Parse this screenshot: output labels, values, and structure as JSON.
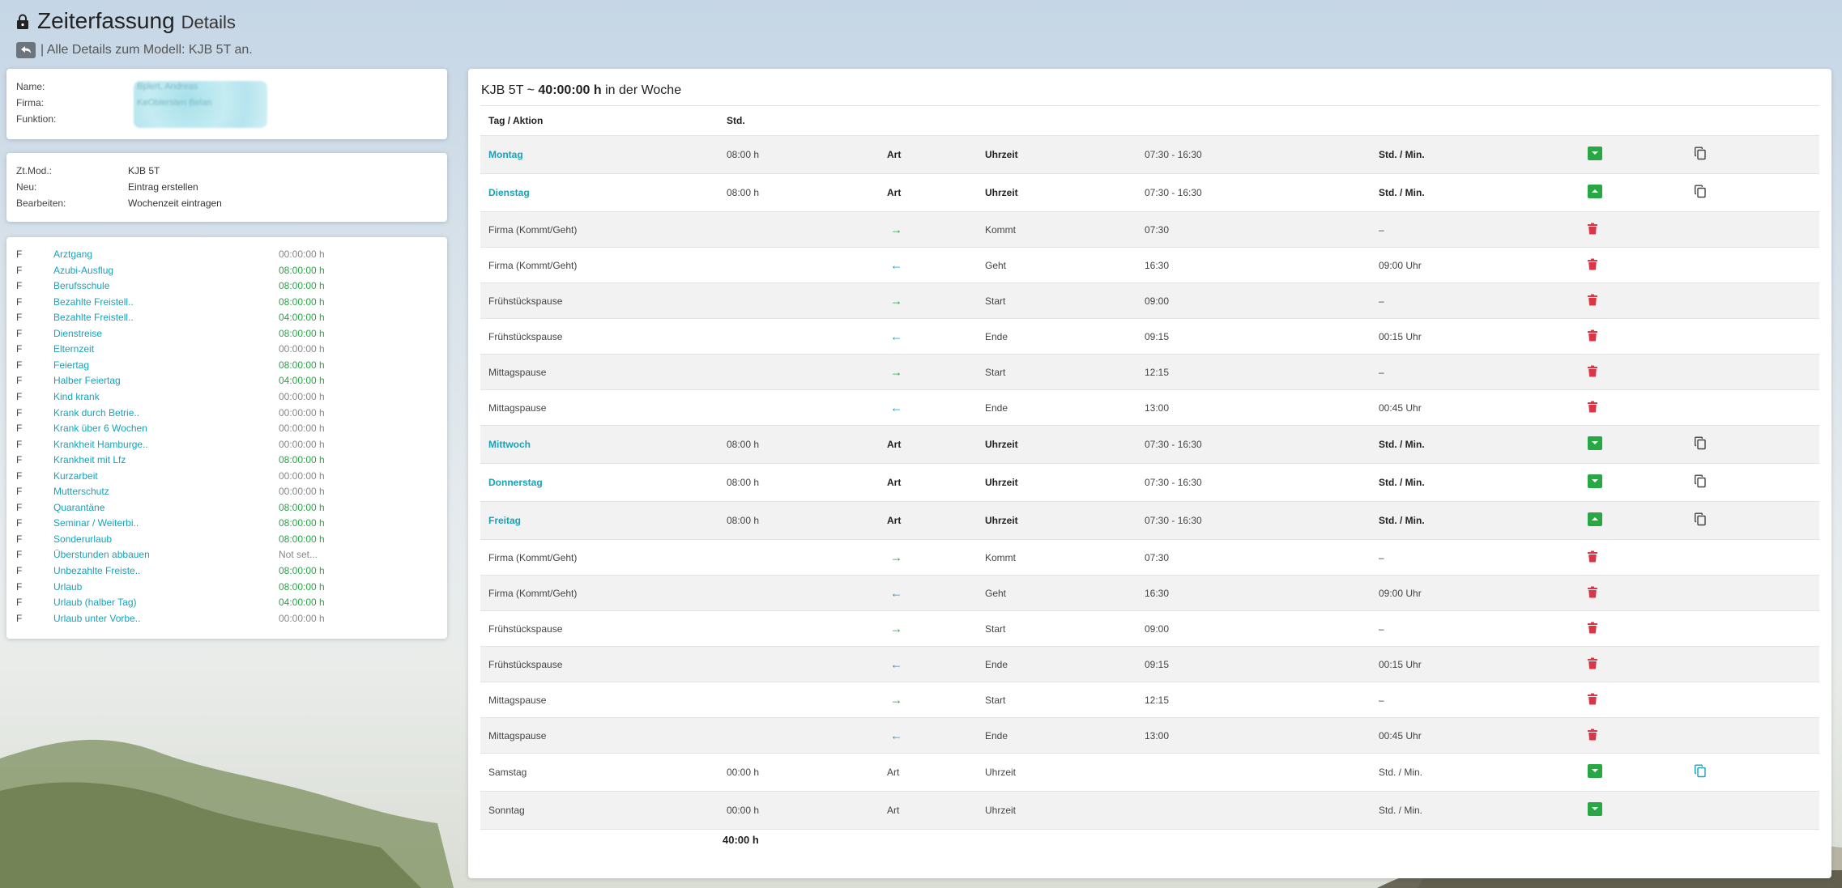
{
  "header": {
    "title": "Zeiterfassung",
    "title_sub": "Details",
    "subtitle": "| Alle Details zum Modell: KJB 5T an."
  },
  "person": {
    "name_label": "Name:",
    "firma_label": "Firma:",
    "funktion_label": "Funktion:",
    "name_value": "Bplert, Andreas",
    "firma_value": "KeOblersten Belan"
  },
  "model": {
    "ztmod_label": "Zt.Mod.:",
    "ztmod_value": "KJB 5T",
    "neu_label": "Neu:",
    "neu_value": "Eintrag erstellen",
    "bearbeiten_label": "Bearbeiten:",
    "bearbeiten_value": "Wochenzeit eintragen"
  },
  "absences": [
    {
      "f": "F",
      "name": "Arztgang",
      "hours": "00:00:00 h",
      "green": false
    },
    {
      "f": "F",
      "name": "Azubi-Ausflug",
      "hours": "08:00:00 h",
      "green": true
    },
    {
      "f": "F",
      "name": "Berufsschule",
      "hours": "08:00:00 h",
      "green": true
    },
    {
      "f": "F",
      "name": "Bezahlte Freistell..",
      "hours": "08:00:00 h",
      "green": true
    },
    {
      "f": "F",
      "name": "Bezahlte Freistell..",
      "hours": "04:00:00 h",
      "green": true
    },
    {
      "f": "F",
      "name": "Dienstreise",
      "hours": "08:00:00 h",
      "green": true
    },
    {
      "f": "F",
      "name": "Elternzeit",
      "hours": "00:00:00 h",
      "green": false
    },
    {
      "f": "F",
      "name": "Feiertag",
      "hours": "08:00:00 h",
      "green": true
    },
    {
      "f": "F",
      "name": "Halber Feiertag",
      "hours": "04:00:00 h",
      "green": true
    },
    {
      "f": "F",
      "name": "Kind krank",
      "hours": "00:00:00 h",
      "green": false
    },
    {
      "f": "F",
      "name": "Krank durch Betrie..",
      "hours": "00:00:00 h",
      "green": false
    },
    {
      "f": "F",
      "name": "Krank über 6 Wochen",
      "hours": "00:00:00 h",
      "green": false
    },
    {
      "f": "F",
      "name": "Krankheit Hamburge..",
      "hours": "00:00:00 h",
      "green": false
    },
    {
      "f": "F",
      "name": "Krankheit mit Lfz",
      "hours": "08:00:00 h",
      "green": true
    },
    {
      "f": "F",
      "name": "Kurzarbeit",
      "hours": "00:00:00 h",
      "green": false
    },
    {
      "f": "F",
      "name": "Mutterschutz",
      "hours": "00:00:00 h",
      "green": false
    },
    {
      "f": "F",
      "name": "Quarantäne",
      "hours": "08:00:00 h",
      "green": true
    },
    {
      "f": "F",
      "name": "Seminar / Weiterbi..",
      "hours": "08:00:00 h",
      "green": true
    },
    {
      "f": "F",
      "name": "Sonderurlaub",
      "hours": "08:00:00 h",
      "green": true
    },
    {
      "f": "F",
      "name": "Überstunden abbauen",
      "hours": "Not set...",
      "green": false
    },
    {
      "f": "F",
      "name": "Unbezahlte Freiste..",
      "hours": "08:00:00 h",
      "green": true
    },
    {
      "f": "F",
      "name": "Urlaub",
      "hours": "08:00:00 h",
      "green": true
    },
    {
      "f": "F",
      "name": "Urlaub (halber Tag)",
      "hours": "04:00:00 h",
      "green": true
    },
    {
      "f": "F",
      "name": "Urlaub unter Vorbe..",
      "hours": "00:00:00 h",
      "green": false
    }
  ],
  "panel": {
    "model": "KJB 5T",
    "sep": " ~ ",
    "hours": "40:00:00 h",
    "suffix": " in der Woche"
  },
  "table": {
    "head_col1": "Tag / Aktion",
    "head_col2": "Std.",
    "total": "40:00 h"
  },
  "rows": [
    {
      "type": "day",
      "alt": true,
      "bold": true,
      "name": "Montag",
      "hours": "08:00 h",
      "art": "Art",
      "uhrzeit": "Uhrzeit",
      "time": "07:30 - 16:30",
      "stdmin": "Std. / Min.",
      "toggle": "down",
      "copy": true
    },
    {
      "type": "day",
      "alt": false,
      "bold": true,
      "name": "Dienstag",
      "hours": "08:00 h",
      "art": "Art",
      "uhrzeit": "Uhrzeit",
      "time": "07:30 - 16:30",
      "stdmin": "Std. / Min.",
      "toggle": "up",
      "copy": true
    },
    {
      "type": "sub",
      "alt": true,
      "name": "Firma (Kommt/Geht)",
      "dir": "in",
      "label": "Kommt",
      "time": "07:30",
      "dur": "–"
    },
    {
      "type": "sub",
      "alt": false,
      "name": "Firma (Kommt/Geht)",
      "dir": "out",
      "label": "Geht",
      "time": "16:30",
      "dur": "09:00 Uhr"
    },
    {
      "type": "sub",
      "alt": true,
      "name": "Frühstückspause",
      "dir": "in",
      "label": "Start",
      "time": "09:00",
      "dur": "–"
    },
    {
      "type": "sub",
      "alt": false,
      "name": "Frühstückspause",
      "dir": "out",
      "label": "Ende",
      "time": "09:15",
      "dur": "00:15 Uhr"
    },
    {
      "type": "sub",
      "alt": true,
      "name": "Mittagspause",
      "dir": "in",
      "label": "Start",
      "time": "12:15",
      "dur": "–"
    },
    {
      "type": "sub",
      "alt": false,
      "name": "Mittagspause",
      "dir": "out",
      "label": "Ende",
      "time": "13:00",
      "dur": "00:45 Uhr"
    },
    {
      "type": "day",
      "alt": true,
      "bold": true,
      "name": "Mittwoch",
      "hours": "08:00 h",
      "art": "Art",
      "uhrzeit": "Uhrzeit",
      "time": "07:30 - 16:30",
      "stdmin": "Std. / Min.",
      "toggle": "down",
      "copy": true
    },
    {
      "type": "day",
      "alt": false,
      "bold": true,
      "name": "Donnerstag",
      "hours": "08:00 h",
      "art": "Art",
      "uhrzeit": "Uhrzeit",
      "time": "07:30 - 16:30",
      "stdmin": "Std. / Min.",
      "toggle": "down",
      "copy": true
    },
    {
      "type": "day",
      "alt": true,
      "bold": true,
      "name": "Freitag",
      "hours": "08:00 h",
      "art": "Art",
      "uhrzeit": "Uhrzeit",
      "time": "07:30 - 16:30",
      "stdmin": "Std. / Min.",
      "toggle": "up",
      "copy": true
    },
    {
      "type": "sub",
      "alt": false,
      "name": "Firma (Kommt/Geht)",
      "dir": "in",
      "label": "Kommt",
      "time": "07:30",
      "dur": "–"
    },
    {
      "type": "sub",
      "alt": true,
      "name": "Firma (Kommt/Geht)",
      "dir": "out",
      "label": "Geht",
      "time": "16:30",
      "dur": "09:00 Uhr"
    },
    {
      "type": "sub",
      "alt": false,
      "name": "Frühstückspause",
      "dir": "in",
      "label": "Start",
      "time": "09:00",
      "dur": "–"
    },
    {
      "type": "sub",
      "alt": true,
      "name": "Frühstückspause",
      "dir": "out",
      "label": "Ende",
      "time": "09:15",
      "dur": "00:15 Uhr"
    },
    {
      "type": "sub",
      "alt": false,
      "name": "Mittagspause",
      "dir": "in",
      "label": "Start",
      "time": "12:15",
      "dur": "–"
    },
    {
      "type": "sub",
      "alt": true,
      "name": "Mittagspause",
      "dir": "out",
      "label": "Ende",
      "time": "13:00",
      "dur": "00:45 Uhr"
    },
    {
      "type": "day",
      "alt": false,
      "bold": false,
      "name": "Samstag",
      "hours": "00:00 h",
      "art": "Art",
      "uhrzeit": "Uhrzeit",
      "time": "",
      "stdmin": "Std. / Min.",
      "toggle": "down",
      "copy": true,
      "copy_blue": true
    },
    {
      "type": "day",
      "alt": true,
      "bold": false,
      "name": "Sonntag",
      "hours": "00:00 h",
      "art": "Art",
      "uhrzeit": "Uhrzeit",
      "time": "",
      "stdmin": "Std. / Min.",
      "toggle": "down",
      "copy": false
    }
  ],
  "colors": {
    "accent": "#17a2b8",
    "success": "#28a745",
    "danger": "#dc3545"
  },
  "icons": {
    "lock": "lock-icon",
    "back": "back-arrow-icon",
    "toggle": "chevron-icon",
    "delete": "trash-icon",
    "copy": "copy-icon",
    "in": "arrow-right-icon",
    "out": "arrow-left-icon"
  }
}
